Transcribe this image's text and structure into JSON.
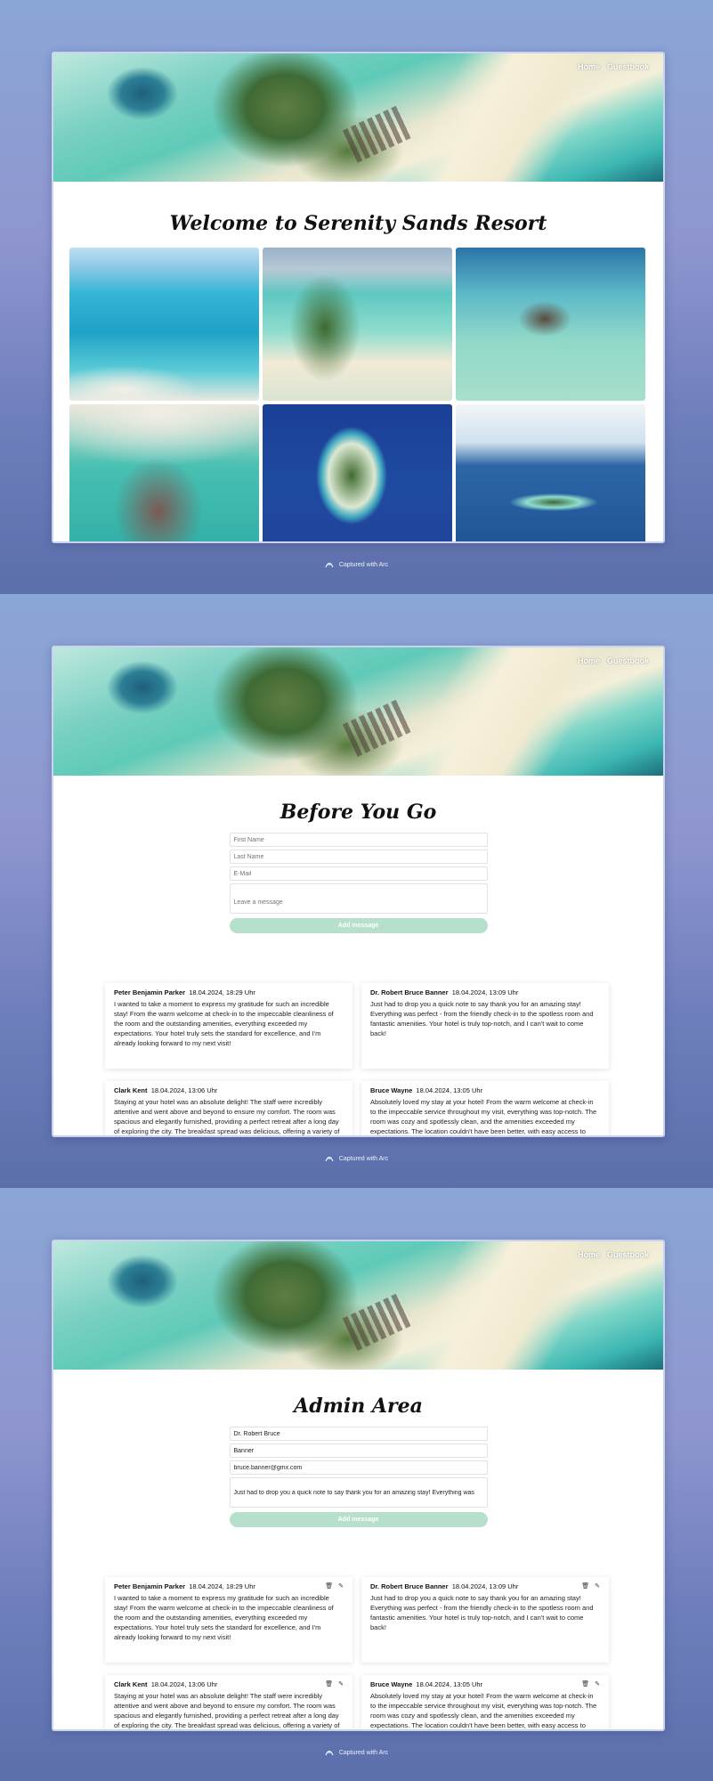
{
  "nav": {
    "home": "Home",
    "guestbook": "Guestbook"
  },
  "caption": "Captured with Arc",
  "home": {
    "title": "Welcome to Serenity Sands Resort"
  },
  "guestbook": {
    "title": "Before You Go",
    "form": {
      "first_name_placeholder": "First Name",
      "last_name_placeholder": "Last Name",
      "email_placeholder": "E-Mail",
      "message_placeholder": "Leave a message",
      "submit": "Add message"
    }
  },
  "admin": {
    "title": "Admin Area",
    "form": {
      "first_name": "Dr. Robert Bruce",
      "last_name": "Banner",
      "email": "bruce.banner@gmx.com",
      "message": "Just had to drop you a quick note to say thank you for an amazing stay! Everything was",
      "submit": "Add message"
    },
    "icons": {
      "delete": "delete-icon",
      "edit": "edit-icon"
    }
  },
  "entries": [
    {
      "name": "Peter Benjamin Parker",
      "date": "18.04.2024, 18:29 Uhr",
      "text": "I wanted to take a moment to express my gratitude for such an incredible stay! From the warm welcome at check-in to the impeccable cleanliness of the room and the outstanding amenities, everything exceeded my expectations. Your hotel truly sets the standard for excellence, and I'm already looking forward to my next visit!"
    },
    {
      "name": "Dr. Robert Bruce Banner",
      "date": "18.04.2024, 13:09 Uhr",
      "text": "Just had to drop you a quick note to say thank you for an amazing stay! Everything was perfect - from the friendly check-in to the spotless room and fantastic amenities. Your hotel is truly top-notch, and I can't wait to come back!"
    },
    {
      "name": "Clark Kent",
      "date": "18.04.2024, 13:06 Uhr",
      "text": "Staying at your hotel was an absolute delight! The staff were incredibly attentive and went above and beyond to ensure my comfort. The room was spacious and elegantly furnished, providing a perfect retreat after a long day of exploring the city. The breakfast spread was delicious, offering a variety of options to suit every taste. Thank you for a wonderful experience—I'll definitely be recommending your hotel to friends and family!"
    },
    {
      "name": "Bruce Wayne",
      "date": "18.04.2024, 13:05 Uhr",
      "text": "Absolutely loved my stay at your hotel! From the warm welcome at check-in to the impeccable service throughout my visit, everything was top-notch. The room was cozy and spotlessly clean, and the amenities exceeded my expectations. The location couldn't have been better, with easy access to attractions and dining options. Thank you for making my stay so memorable! I'll definitely be back!"
    }
  ]
}
